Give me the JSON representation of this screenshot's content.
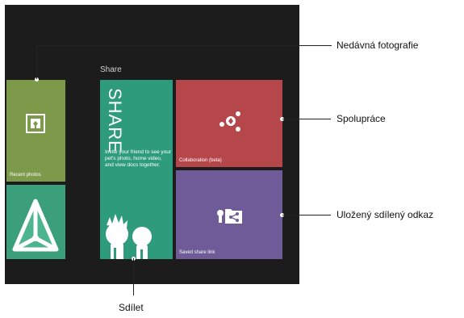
{
  "group": {
    "title": "Share"
  },
  "tiles": {
    "recent_photos": {
      "label": "Recent photos",
      "color": "#7d9a4a"
    },
    "share": {
      "title": "SHARE",
      "description": "Invite your friend to see your pet's photo, home video, and view docs together.",
      "color": "#2e9b7c"
    },
    "collaboration": {
      "label": "Collaboration (beta)",
      "color": "#b5474b"
    },
    "saved_share_link": {
      "label": "Saved share link",
      "color": "#6e5b97"
    },
    "map_tile": {
      "color": "#3a9f7a"
    }
  },
  "callouts": {
    "recent_photo": "Nedávná fotografie",
    "collaboration": "Spolupráce",
    "saved_link": "Uložený sdílený odkaz",
    "share": "Sdílet"
  },
  "icons": {
    "recent_photos": "photo-frame-icon",
    "collaboration": "collaboration-icon",
    "saved_share_link": "key-folder-share-icon",
    "share_illustration": "pet-characters-icon",
    "map_tile": "triangle-logo-icon"
  }
}
